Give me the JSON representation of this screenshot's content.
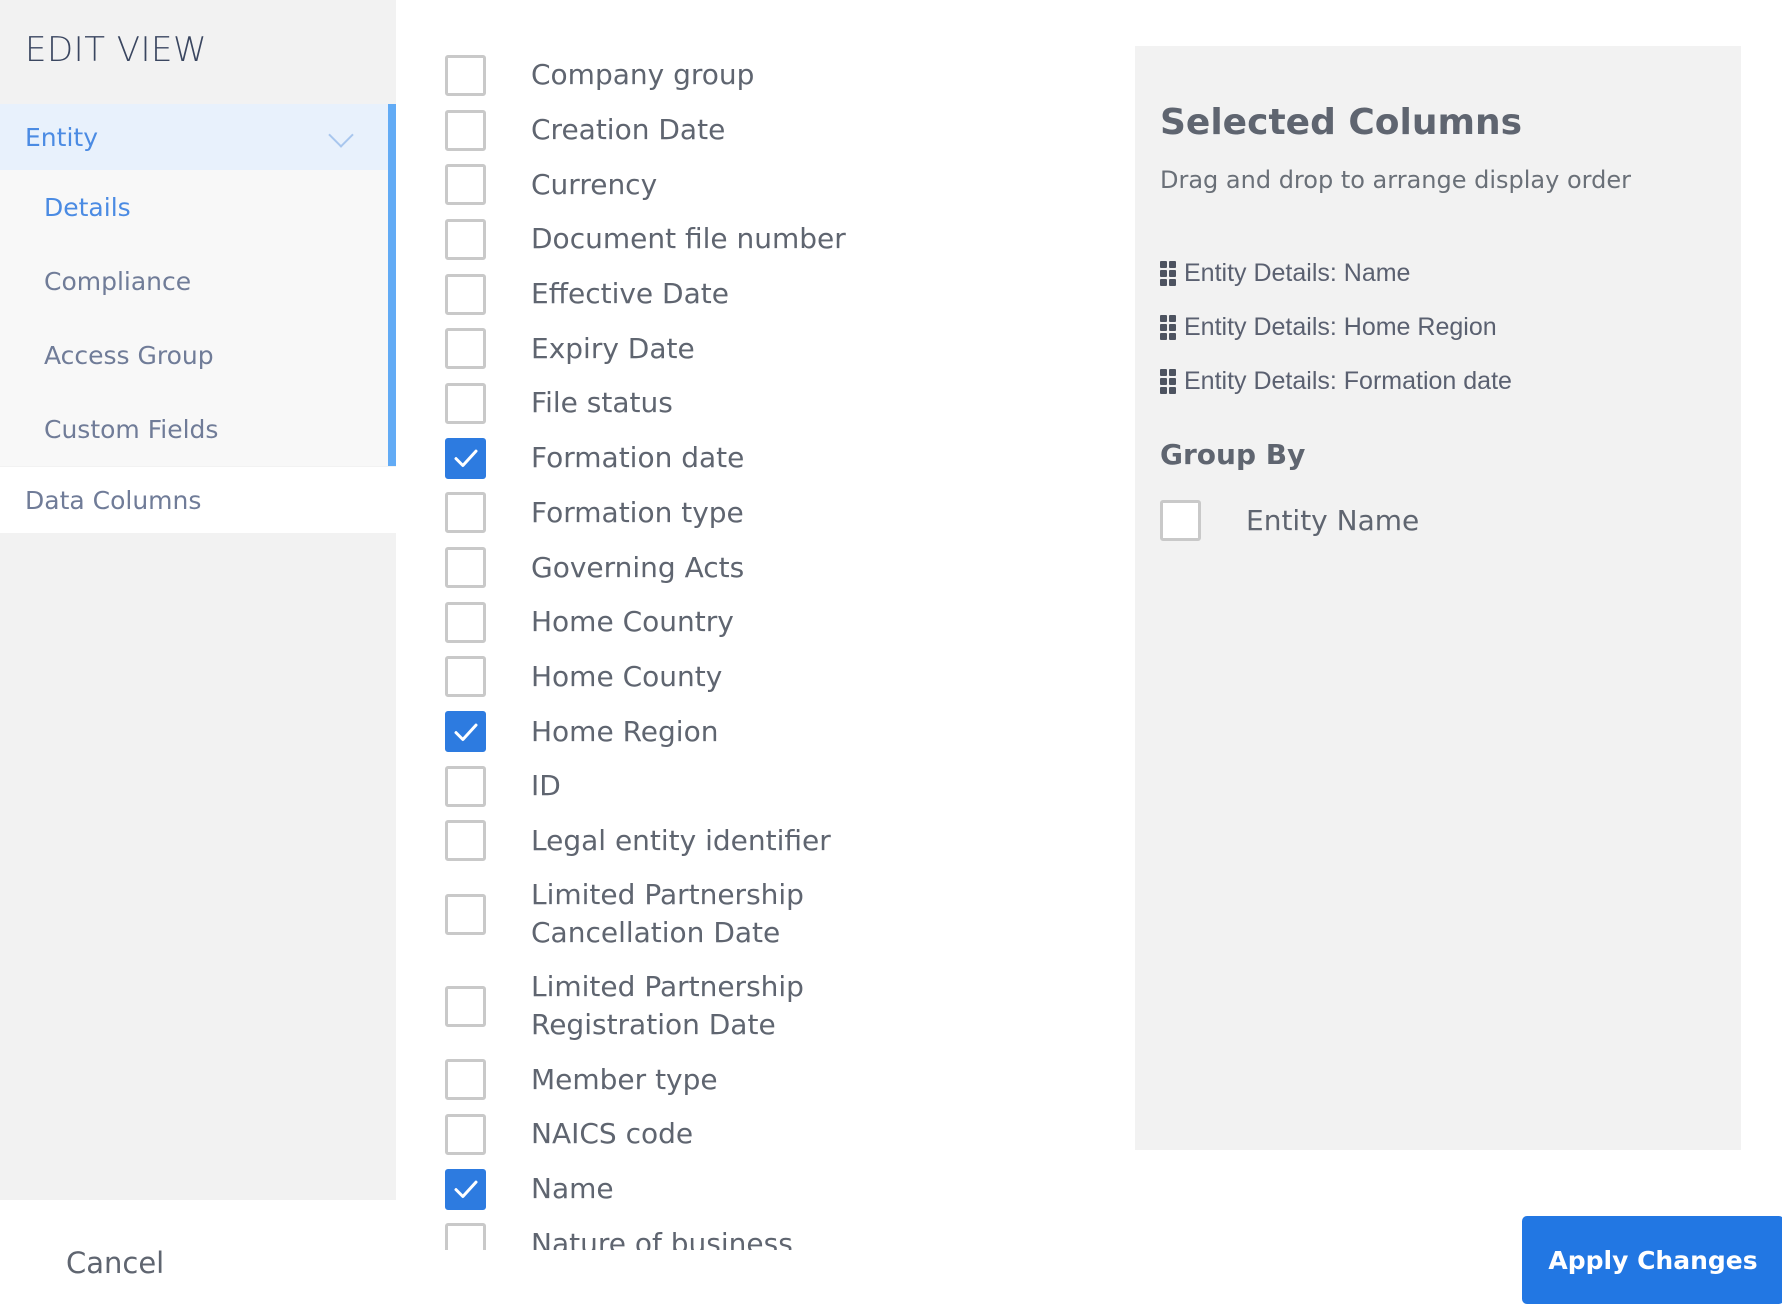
{
  "sidebar": {
    "title": "EDIT VIEW",
    "entity_label": "Entity",
    "sub_items": [
      {
        "label": "Details",
        "active": true
      },
      {
        "label": "Compliance",
        "active": false
      },
      {
        "label": "Access Group",
        "active": false
      },
      {
        "label": "Custom Fields",
        "active": false
      }
    ],
    "data_columns_label": "Data Columns"
  },
  "columns": [
    {
      "label": "Company group",
      "checked": false
    },
    {
      "label": "Creation Date",
      "checked": false
    },
    {
      "label": "Currency",
      "checked": false
    },
    {
      "label": "Document file number",
      "checked": false
    },
    {
      "label": "Effective Date",
      "checked": false
    },
    {
      "label": "Expiry Date",
      "checked": false
    },
    {
      "label": "File status",
      "checked": false
    },
    {
      "label": "Formation date",
      "checked": true
    },
    {
      "label": "Formation type",
      "checked": false
    },
    {
      "label": "Governing Acts",
      "checked": false
    },
    {
      "label": "Home Country",
      "checked": false
    },
    {
      "label": "Home County",
      "checked": false
    },
    {
      "label": "Home Region",
      "checked": true
    },
    {
      "label": "ID",
      "checked": false
    },
    {
      "label": "Legal entity identifier",
      "checked": false
    },
    {
      "label": "Limited Partnership Cancellation Date",
      "checked": false
    },
    {
      "label": "Limited Partnership Registration Date",
      "checked": false
    },
    {
      "label": "Member type",
      "checked": false
    },
    {
      "label": "NAICS code",
      "checked": false
    },
    {
      "label": "Name",
      "checked": true
    },
    {
      "label": "Nature of business",
      "checked": false
    }
  ],
  "panel": {
    "title": "Selected Columns",
    "subtitle": "Drag and drop to arrange display order",
    "selected": [
      "Entity Details: Name",
      "Entity Details: Home Region",
      "Entity Details: Formation date"
    ],
    "group_by_title": "Group By",
    "group_by_option": {
      "label": "Entity Name",
      "checked": false
    }
  },
  "footer": {
    "cancel_label": "Cancel",
    "apply_label": "Apply Changes"
  },
  "colors": {
    "accent": "#2277e3",
    "sidebar_highlight": "#62abf5"
  }
}
